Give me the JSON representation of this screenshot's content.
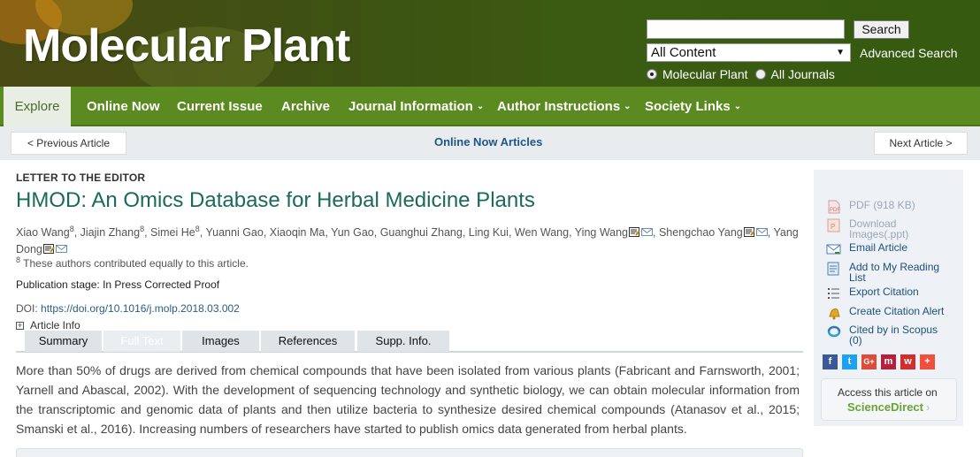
{
  "header": {
    "logo": "Molecular Plant",
    "search_button": "Search",
    "content_select": "All Content",
    "advanced_search": "Advanced Search",
    "radio_journal": "Molecular Plant",
    "radio_all": "All Journals"
  },
  "nav": {
    "explore": "Explore",
    "items": [
      "Online Now",
      "Current Issue",
      "Archive",
      "Journal Information",
      "Author Instructions",
      "Society Links"
    ]
  },
  "pager": {
    "prev": "< Previous Article",
    "center": "Online Now Articles",
    "next": "Next Article >"
  },
  "article": {
    "kind": "LETTER TO THE EDITOR",
    "title": "HMOD: An Omics Database for Herbal Medicine Plants",
    "authors": [
      {
        "name": "Xiao Wang",
        "sup": "8"
      },
      {
        "name": "Jiajin Zhang",
        "sup": "8"
      },
      {
        "name": "Simei He",
        "sup": "8"
      },
      {
        "name": "Yuanni Gao",
        "sup": ""
      },
      {
        "name": "Xiaoqin Ma",
        "sup": ""
      },
      {
        "name": "Yun Gao",
        "sup": ""
      },
      {
        "name": "Guanghui Zhang",
        "sup": ""
      },
      {
        "name": "Ling Kui",
        "sup": ""
      },
      {
        "name": "Wen Wang",
        "sup": ""
      },
      {
        "name": "Ying Wang",
        "sup": ""
      },
      {
        "name": "Shengchao Yang",
        "sup": ""
      },
      {
        "name": "Yang Dong",
        "sup": ""
      }
    ],
    "footnote_sup": "8",
    "footnote": "These authors contributed equally to this article.",
    "publication_stage": "Publication stage: In Press Corrected Proof",
    "doi_label": "DOI:",
    "doi_link": "https://doi.org/10.1016/j.molp.2018.03.002",
    "article_info": "Article Info",
    "tabs": [
      "Summary",
      "Full Text",
      "Images",
      "References",
      "Supp. Info."
    ],
    "body": "More than 50% of drugs are derived from chemical compounds that have been isolated from various plants (Fabricant and Farnsworth, 2001; Yarnell and Abascal, 2002). With the development of sequencing technology and synthetic biology, we can obtain molecular information from the transcriptomic and genomic data of plants and then utilize bacteria to synthesize desired chemical compounds (Atanasov et al., 2015; Smanski et al., 2016). Increasing numbers of researchers have started to publish omics data generated from herbal plants."
  },
  "sidebar": {
    "pdf": "PDF (918 KB)",
    "download_images": "Download Images(.ppt)",
    "email": "Email Article",
    "reading_list": "Add to My Reading List",
    "export_citation": "Export Citation",
    "citation_alert": "Create Citation Alert",
    "scopus": "Cited by in Scopus (0)",
    "access_text": "Access this article on",
    "sciencedirect": "ScienceDirect",
    "chevron": "›"
  },
  "colors": {
    "nav_green": "#5b8a20",
    "title_teal": "#1a6a5a",
    "link_blue": "#1d4f7a"
  }
}
